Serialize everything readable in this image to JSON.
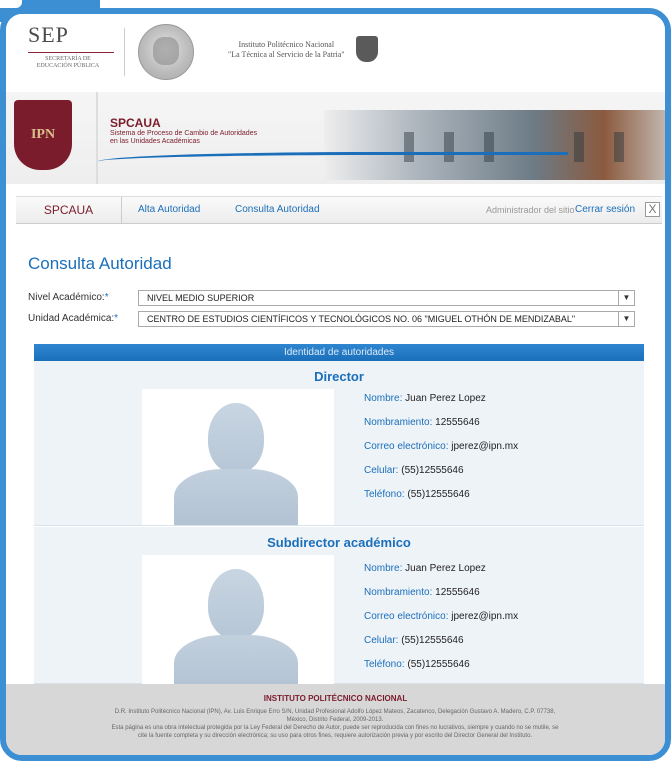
{
  "gov_header": {
    "sep_title": "SEP",
    "sep_subtitle": "SECRETARÍA DE EDUCACIÓN PÚBLICA",
    "ipn_line1": "Instituto Politécnico Nacional",
    "ipn_line2": "\"La Técnica al Servicio de la Patria\""
  },
  "banner": {
    "title": "SPCAUA",
    "subtitle_line1": "Sistema de Proceso de Cambio de Autoridades",
    "subtitle_line2": "en las Unidades Académicas",
    "logo_text": "IPN"
  },
  "nav": {
    "brand": "SPCAUA",
    "links": [
      "Alta Autoridad",
      "Consulta Autoridad"
    ],
    "admin": "Administrador del sitio",
    "logout": "Cerrar sesión",
    "close": "X"
  },
  "form": {
    "title": "Consulta Autoridad",
    "nivel_label": "Nivel Académico:",
    "nivel_value": "NIVEL MEDIO SUPERIOR",
    "unidad_label": "Unidad Académica:",
    "unidad_value": "CENTRO DE ESTUDIOS CIENTÍFICOS Y TECNOLÓGICOS NO. 06 \"MIGUEL OTHÓN DE MENDIZABAL\"",
    "required_mark": "*",
    "arrow": "▼"
  },
  "section_title": "Identidad de autoridades",
  "authorities": [
    {
      "role": "Director",
      "name_label": "Nombre:",
      "name": "Juan Perez Lopez",
      "appointment_label": "Nombramiento:",
      "appointment": "12555646",
      "email_label": "Correo electrónico:",
      "email": "jperez@ipn.mx",
      "cell_label": "Celular:",
      "cell": "(55)12555646",
      "phone_label": "Teléfono:",
      "phone": "(55)12555646"
    },
    {
      "role": "Subdirector académico",
      "name_label": "Nombre:",
      "name": "Juan Perez Lopez",
      "appointment_label": "Nombramiento:",
      "appointment": "12555646",
      "email_label": "Correo electrónico:",
      "email": "jperez@ipn.mx",
      "cell_label": "Celular:",
      "cell": "(55)12555646",
      "phone_label": "Teléfono:",
      "phone": "(55)12555646"
    }
  ],
  "footer": {
    "title": "INSTITUTO POLITÉCNICO NACIONAL",
    "line1": "D.R. Instituto Politécnico Nacional (IPN), Av. Luis Enrique Erro S/N, Unidad Profesional Adolfo López Mateos, Zacatenco, Delegación Gustavo A. Madero, C.P. 07738,",
    "line2": "México, Distrito Federal, 2009-2013.",
    "line3": "Esta página es una obra intelectual protegida por la Ley Federal del Derecho de Autor, puede ser reproducida con fines no lucrativos, siempre y cuando no se mutile, se",
    "line4": "cite la fuente completa y su dirección electrónica; su uso para otros fines, requiere autorización previa y por escrito del Director General del Instituto."
  },
  "colors": {
    "frame": "#3d8fd3",
    "accent_blue": "#1b6fba",
    "ipn_guinda": "#7b1c2c",
    "footer_bg": "#d7d7d7"
  },
  "icons": {
    "close": "close-icon",
    "dropdown": "chevron-down-icon"
  }
}
